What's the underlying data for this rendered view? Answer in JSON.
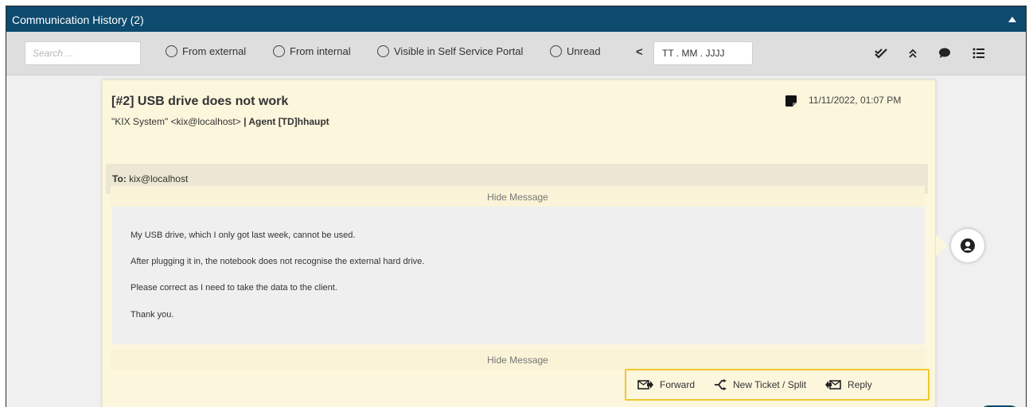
{
  "header": {
    "title": "Communication History (2)"
  },
  "toolbar": {
    "search_placeholder": "Search ...",
    "filters": [
      {
        "label": "From external"
      },
      {
        "label": "From internal"
      },
      {
        "label": "Visible in Self Service Portal"
      },
      {
        "label": "Unread"
      }
    ],
    "date_value": "TT . MM . JJJJ",
    "icons": [
      "double-check-icon",
      "collapse-all-icon",
      "chat-bubble-icon",
      "list-icon"
    ]
  },
  "article": {
    "subject": "[#2] USB drive does not work",
    "from_text": "\"KIX System\" <kix@localhost>",
    "separator": " | ",
    "agent": "Agent [TD]hhaupt",
    "date": "11/11/2022, 01:07 PM",
    "to_label": "To:",
    "to_value": "kix@localhost",
    "hide_message_label": "Hide Message",
    "body": [
      "My USB drive, which I only got last week, cannot be used.",
      "After plugging it in, the notebook does not recognise the external hard drive.",
      "Please correct as I need to take the data to the client.",
      "Thank you."
    ],
    "actions": {
      "forward": "Forward",
      "new_ticket": "New Ticket / Split",
      "reply": "Reply"
    }
  },
  "colors": {
    "header_bg": "#0e4a6e",
    "article_bg": "#fcf6dd",
    "action_border": "#f0c82c"
  }
}
